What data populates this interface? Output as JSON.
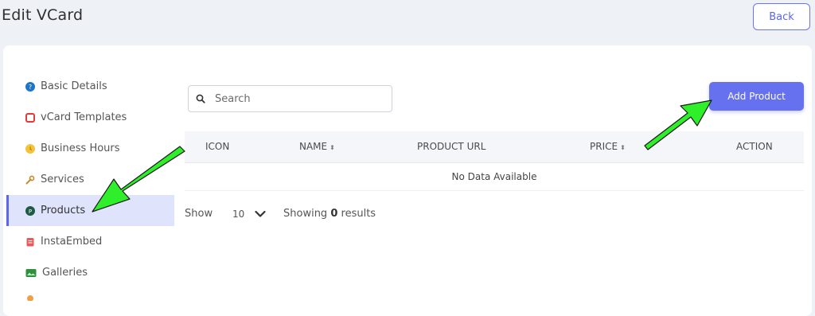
{
  "header": {
    "title": "Edit VCard",
    "back_label": "Back"
  },
  "sidebar": {
    "items": [
      {
        "label": "Basic Details",
        "icon": "info-circle-icon"
      },
      {
        "label": "vCard Templates",
        "icon": "template-icon"
      },
      {
        "label": "Business Hours",
        "icon": "clock-icon"
      },
      {
        "label": "Services",
        "icon": "wrench-icon"
      },
      {
        "label": "Products",
        "icon": "product-icon",
        "active": true
      },
      {
        "label": "InstaEmbed",
        "icon": "instagram-icon"
      },
      {
        "label": "Galleries",
        "icon": "gallery-icon"
      }
    ]
  },
  "toolbar": {
    "search_placeholder": "Search",
    "add_label": "Add Product"
  },
  "table": {
    "columns": [
      "ICON",
      "NAME",
      "PRODUCT URL",
      "PRICE",
      "ACTION"
    ],
    "sortable": [
      false,
      true,
      false,
      true,
      false
    ],
    "empty_text": "No Data Available"
  },
  "footer": {
    "show_label": "Show",
    "page_size": "10",
    "showing_prefix": "Showing",
    "showing_count": "0",
    "showing_suffix": "results"
  },
  "colors": {
    "accent": "#6571ef",
    "active_bg": "#dfe3fb",
    "annotation_arrow": "#22ee22"
  }
}
